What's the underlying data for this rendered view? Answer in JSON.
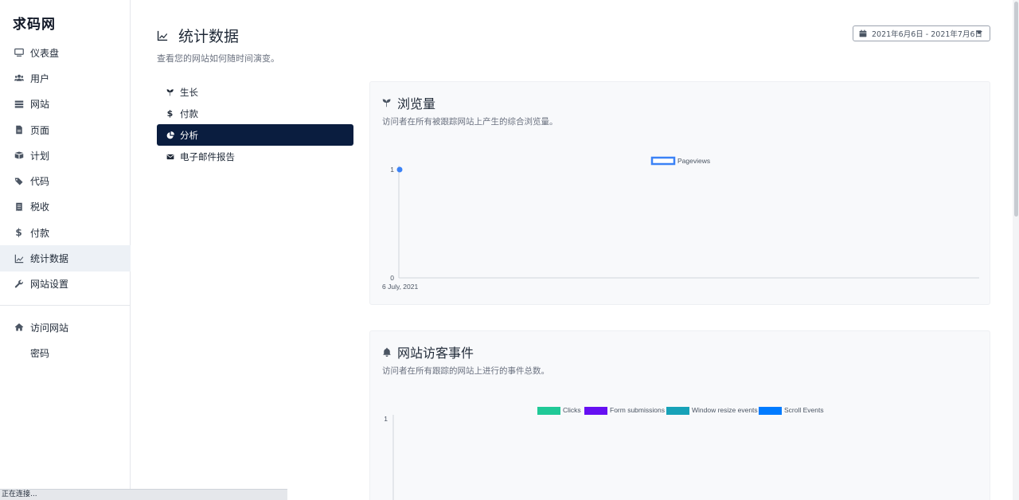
{
  "brand": "求码网",
  "sidebar": {
    "items": [
      {
        "label": "仪表盘",
        "icon": "monitor-icon"
      },
      {
        "label": "用户",
        "icon": "users-icon"
      },
      {
        "label": "网站",
        "icon": "server-icon"
      },
      {
        "label": "页面",
        "icon": "file-icon"
      },
      {
        "label": "计划",
        "icon": "box-icon"
      },
      {
        "label": "代码",
        "icon": "tags-icon"
      },
      {
        "label": "税收",
        "icon": "receipt-icon"
      },
      {
        "label": "付款",
        "icon": "dollar-icon"
      },
      {
        "label": "统计数据",
        "icon": "chart-line-icon",
        "active": true
      },
      {
        "label": "网站设置",
        "icon": "wrench-icon"
      }
    ],
    "bottom_items": [
      {
        "label": "访问网站",
        "icon": "home-icon"
      },
      {
        "label": "密码",
        "icon": ""
      }
    ]
  },
  "header": {
    "title": "统计数据",
    "subtitle": "查看您的网站如何随时间演变。",
    "date_range": "2021年6月6日 - 2021年7月6日"
  },
  "submenu": [
    {
      "label": "生长",
      "icon": "seedling-icon"
    },
    {
      "label": "付款",
      "icon": "dollar-icon"
    },
    {
      "label": "分析",
      "icon": "pie-chart-icon",
      "active": true
    },
    {
      "label": "电子邮件报告",
      "icon": "envelope-icon"
    }
  ],
  "cards": {
    "pageviews": {
      "title": "浏览量",
      "desc": "访问者在所有被跟踪网站上产生的综合浏览量。"
    },
    "events": {
      "title": "网站访客事件",
      "desc": "访问者在所有跟踪的网站上进行的事件总数。"
    }
  },
  "status_text": "正在连接...",
  "colors": {
    "accent_dark": "#0a1d3f",
    "pageviews": "#3b82f6",
    "clicks": "#20c997",
    "form_submissions": "#6610f2",
    "window_resize": "#17a2b8",
    "scroll_events": "#007bff"
  },
  "chart_data": [
    {
      "type": "line",
      "x": [
        "6 July, 2021"
      ],
      "series": [
        {
          "name": "Pageviews",
          "values": [
            1
          ]
        }
      ],
      "yticks": [
        "0",
        "1"
      ],
      "ylim": [
        0,
        1
      ],
      "legend": "top-center"
    },
    {
      "type": "line",
      "x": [],
      "series": [
        {
          "name": "Clicks",
          "values": []
        },
        {
          "name": "Form submissions",
          "values": []
        },
        {
          "name": "Window resize events",
          "values": []
        },
        {
          "name": "Scroll Events",
          "values": []
        }
      ],
      "yticks": [
        "1"
      ],
      "legend": "top-center"
    }
  ]
}
